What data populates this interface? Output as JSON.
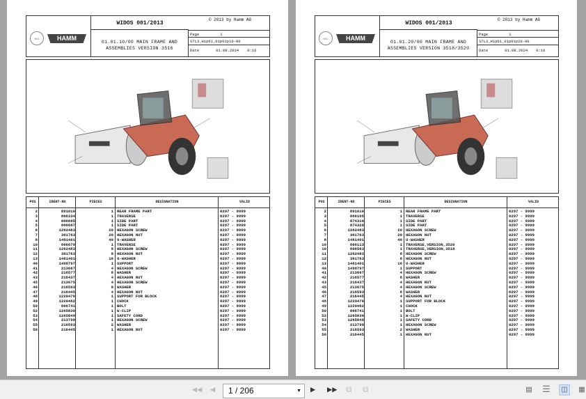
{
  "viewer": {
    "page_input": "1 / 206"
  },
  "pages": [
    {
      "widos": "WIDOS 001/2013",
      "copyright": "© 2013 by Hamm AG",
      "logo_hamm": "HAMM",
      "logo_wirtgen": "WIRTGEN GROUP",
      "title_line1": "01.01.10/00 MAIN FRAME AND",
      "title_line2": "ASSEMBLIES  VERSION 3516",
      "page_label": "Page",
      "page_num": "1",
      "doc_id": "STL3_H1p61_01p01p10-00",
      "date_label": "Date",
      "date": "01.08.2024",
      "time": "0:16",
      "headers": [
        "POS",
        "IDENT-NO",
        "PIECES",
        "DESIGNATION",
        "VALID"
      ],
      "rows": [
        [
          "2",
          "891010",
          "1",
          "REAR FRAME PART",
          "0297 - 9999"
        ],
        [
          "3",
          "866334",
          "1",
          "TRAVERSE",
          "0297 - 9999"
        ],
        [
          "4",
          "866695",
          "1",
          "SIDE PART",
          "0297 - 9999"
        ],
        [
          "5",
          "866687",
          "1",
          "SIDE PART",
          "0297 - 9999"
        ],
        [
          "6",
          "1262483",
          "20",
          "HEXAGON SCREW",
          "0297 - 9999"
        ],
        [
          "7",
          "361763",
          "20",
          "HEXAGON NUT",
          "0297 - 9999"
        ],
        [
          "8",
          "1481401",
          "40",
          "U-WASHER",
          "0297 - 9999"
        ],
        [
          "10",
          "866679",
          "1",
          "TRAVERSE",
          "0297 - 9999"
        ],
        [
          "11",
          "1262483",
          "8",
          "HEXAGON SCREW",
          "0297 - 9999"
        ],
        [
          "12",
          "361763",
          "8",
          "HEXAGON NUT",
          "0297 - 9999"
        ],
        [
          "13",
          "1481401",
          "16",
          "U-WASHER",
          "0297 - 9999"
        ],
        [
          "40",
          "1498797",
          "1",
          "SUPPORT",
          "0297 - 9999"
        ],
        [
          "41",
          "213667",
          "4",
          "HEXAGON SCREW",
          "0297 - 9999"
        ],
        [
          "42",
          "216577",
          "8",
          "WASHER",
          "0297 - 9999"
        ],
        [
          "43",
          "216437",
          "4",
          "HEXAGON NUT",
          "0297 - 9999"
        ],
        [
          "45",
          "213675",
          "4",
          "HEXAGON SCREW",
          "0297 - 9999"
        ],
        [
          "46",
          "216593",
          "8",
          "WASHER",
          "0297 - 9999"
        ],
        [
          "47",
          "216445",
          "4",
          "HEXAGON NUT",
          "0297 - 9999"
        ],
        [
          "48",
          "1220470",
          "1",
          "SUPPORT FOR BLOCK",
          "0297 - 9999"
        ],
        [
          "49",
          "1220462",
          "1",
          "CHOCK",
          "0297 - 9999"
        ],
        [
          "50",
          "866741",
          "1",
          "BOLT",
          "0297 - 9999"
        ],
        [
          "52",
          "1265830",
          "1",
          "W-CLIP",
          "0297 - 9999"
        ],
        [
          "53",
          "1265849",
          "1",
          "SAFETY CORD",
          "0297 - 9999"
        ],
        [
          "54",
          "213799",
          "1",
          "HEXAGON SCREW",
          "0297 - 9999"
        ],
        [
          "55",
          "216593",
          "2",
          "WASHER",
          "0297 - 9999"
        ],
        [
          "56",
          "216445",
          "1",
          "HEXAGON NUT",
          "0297 - 9999"
        ]
      ]
    },
    {
      "widos": "WIDOS 001/2013",
      "copyright": "© 2013 by Hamm AG",
      "logo_hamm": "HAMM",
      "logo_wirtgen": "WIRTGEN GROUP",
      "title_line1": "01.01.20/00 MAIN FRAME AND",
      "title_line2": "ASSEMBLIES  VERSION 3518/3520",
      "page_label": "Page",
      "page_num": "1",
      "doc_id": "STL3_H1p61_01p01p20-00",
      "date_label": "Date",
      "date": "01.08.2024",
      "time": "0:16",
      "headers": [
        "POS",
        "IDENT-NO",
        "PIECES",
        "DESIGNATION",
        "VALID"
      ],
      "rows": [
        [
          "2",
          "891010",
          "1",
          "REAR FRAME PART",
          "0297 - 9999"
        ],
        [
          "3",
          "866105",
          "1",
          "TRAVERSE",
          "0297 - 9999"
        ],
        [
          "4",
          "874310",
          "1",
          "SIDE PART",
          "0297 - 9999"
        ],
        [
          "5",
          "874329",
          "1",
          "SIDE PART",
          "0297 - 9999"
        ],
        [
          "6",
          "1262483",
          "20",
          "HEXAGON SCREW",
          "0297 - 9999"
        ],
        [
          "7",
          "361763",
          "20",
          "HEXAGON NUT",
          "0297 - 9999"
        ],
        [
          "8",
          "1481401",
          "40",
          "U-WASHER",
          "0297 - 9999"
        ],
        [
          "10",
          "866113",
          "1",
          "TRAVERSE,VERSION,3520",
          "0297 - 9999"
        ],
        [
          "10",
          "866563",
          "1",
          "TRAVERSE,VERSION,3518",
          "0297 - 9999"
        ],
        [
          "11",
          "1262483",
          "8",
          "HEXAGON SCREW",
          "0297 - 9999"
        ],
        [
          "12",
          "361763",
          "8",
          "HEXAGON NUT",
          "0297 - 9999"
        ],
        [
          "13",
          "1481401",
          "16",
          "U-WASHER",
          "0297 - 9999"
        ],
        [
          "40",
          "1498797",
          "1",
          "SUPPORT",
          "0297 - 9999"
        ],
        [
          "41",
          "213667",
          "4",
          "HEXAGON SCREW",
          "0297 - 9999"
        ],
        [
          "42",
          "216577",
          "8",
          "WASHER",
          "0297 - 9999"
        ],
        [
          "43",
          "216437",
          "4",
          "HEXAGON NUT",
          "0297 - 9999"
        ],
        [
          "45",
          "213675",
          "4",
          "HEXAGON SCREW",
          "0297 - 9999"
        ],
        [
          "46",
          "216593",
          "8",
          "WASHER",
          "0297 - 9999"
        ],
        [
          "47",
          "216445",
          "4",
          "HEXAGON NUT",
          "0297 - 9999"
        ],
        [
          "48",
          "1220470",
          "1",
          "SUPPORT FOR BLOCK",
          "0297 - 9999"
        ],
        [
          "49",
          "1220462",
          "1",
          "CHOCK",
          "0297 - 9999"
        ],
        [
          "50",
          "866741",
          "1",
          "BOLT",
          "0297 - 9999"
        ],
        [
          "52",
          "1265830",
          "1",
          "W-CLIP",
          "0297 - 9999"
        ],
        [
          "53",
          "1265849",
          "1",
          "SAFETY CORD",
          "0297 - 9999"
        ],
        [
          "54",
          "213799",
          "1",
          "HEXAGON SCREW",
          "0297 - 9999"
        ],
        [
          "55",
          "216593",
          "2",
          "WASHER",
          "0297 - 9999"
        ],
        [
          "56",
          "216445",
          "1",
          "HEXAGON NUT",
          "0297 - 9999"
        ]
      ]
    }
  ]
}
